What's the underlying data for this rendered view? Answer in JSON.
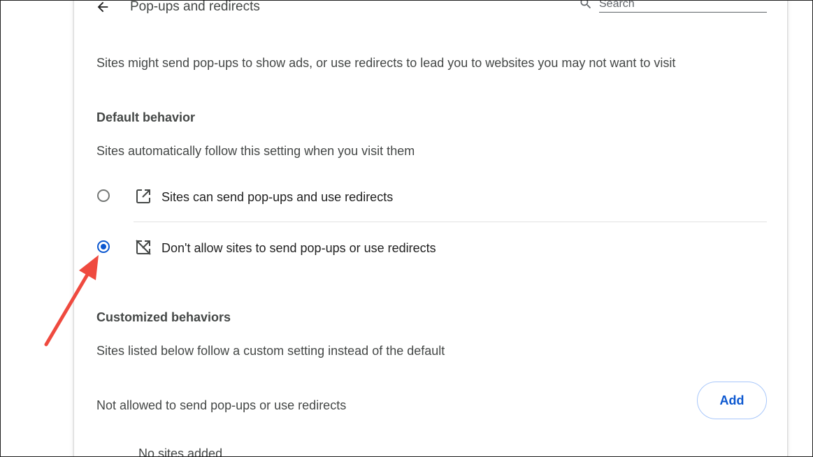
{
  "header": {
    "title": "Pop-ups and redirects",
    "search_placeholder": "Search"
  },
  "intro": "Sites might send pop-ups to show ads, or use redirects to lead you to websites you may not want to visit",
  "default_behavior": {
    "heading": "Default behavior",
    "description": "Sites automatically follow this setting when you visit them",
    "options": [
      {
        "label": "Sites can send pop-ups and use redirects",
        "selected": false,
        "icon": "open-in-new-icon"
      },
      {
        "label": "Don't allow sites to send pop-ups or use redirects",
        "selected": true,
        "icon": "open-in-new-off-icon"
      }
    ]
  },
  "customized_behaviors": {
    "heading": "Customized behaviors",
    "description": "Sites listed below follow a custom setting instead of the default",
    "not_allowed": {
      "label": "Not allowed to send pop-ups or use redirects",
      "add_label": "Add",
      "empty_text": "No sites added"
    }
  },
  "colors": {
    "accent": "#0b57d0",
    "annotation_arrow": "#ef4a3f"
  }
}
